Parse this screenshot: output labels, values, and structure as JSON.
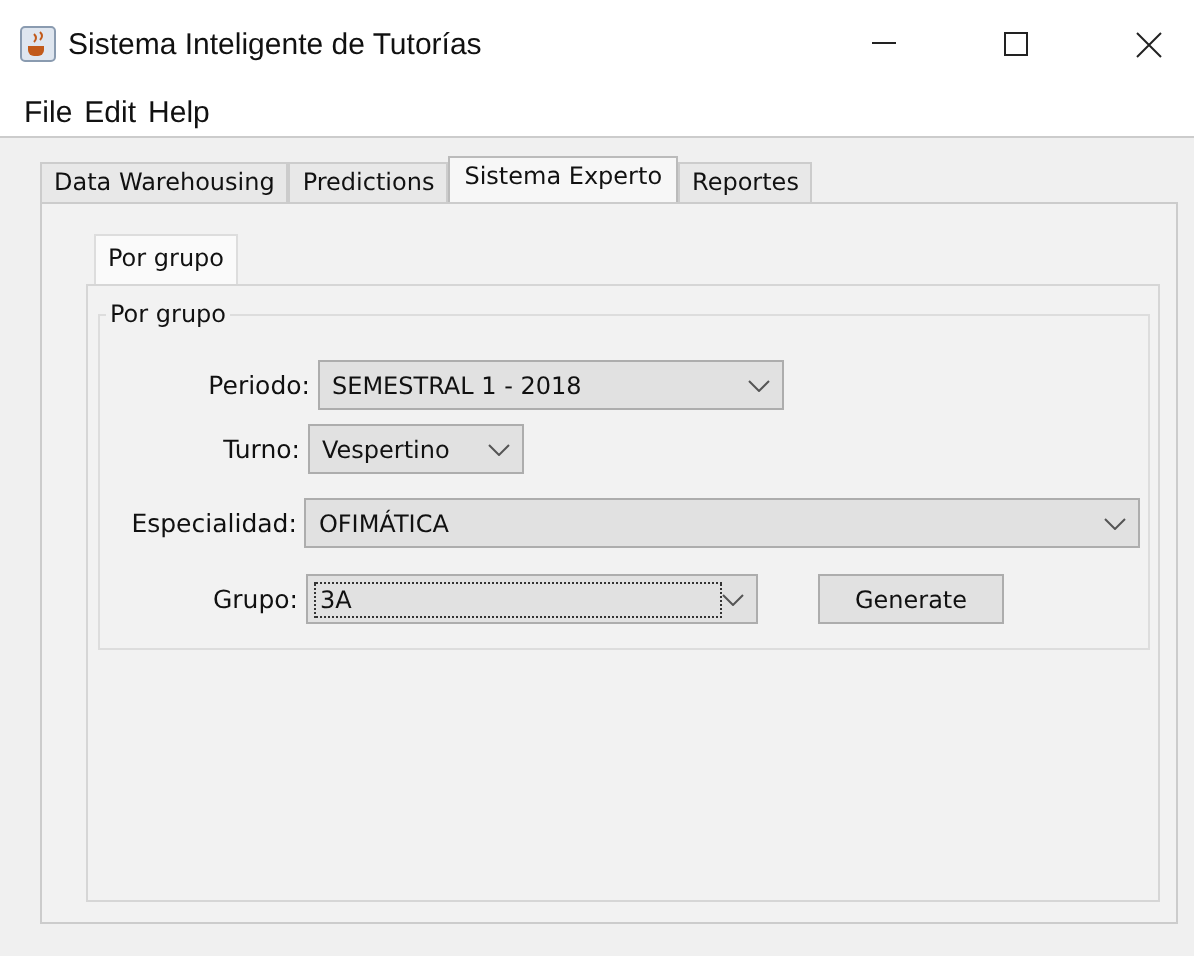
{
  "window": {
    "title": "Sistema Inteligente de Tutorías"
  },
  "menu": [
    "File",
    "Edit",
    "Help"
  ],
  "tabs": [
    {
      "label": "Data Warehousing",
      "selected": false
    },
    {
      "label": "Predictions",
      "selected": false
    },
    {
      "label": "Sistema Experto",
      "selected": true
    },
    {
      "label": "Reportes",
      "selected": false
    }
  ],
  "subtabs": [
    {
      "label": "Por grupo",
      "selected": true
    }
  ],
  "group": {
    "title": "Por grupo",
    "fields": [
      {
        "label": "Periodo:",
        "value": "SEMESTRAL 1 - 2018",
        "focused": false
      },
      {
        "label": "Turno:",
        "value": "Vespertino",
        "focused": false
      },
      {
        "label": "Especialidad:",
        "value": "OFIMÁTICA",
        "focused": false
      },
      {
        "label": "Grupo:",
        "value": "3A",
        "focused": true
      }
    ],
    "button": "Generate"
  }
}
